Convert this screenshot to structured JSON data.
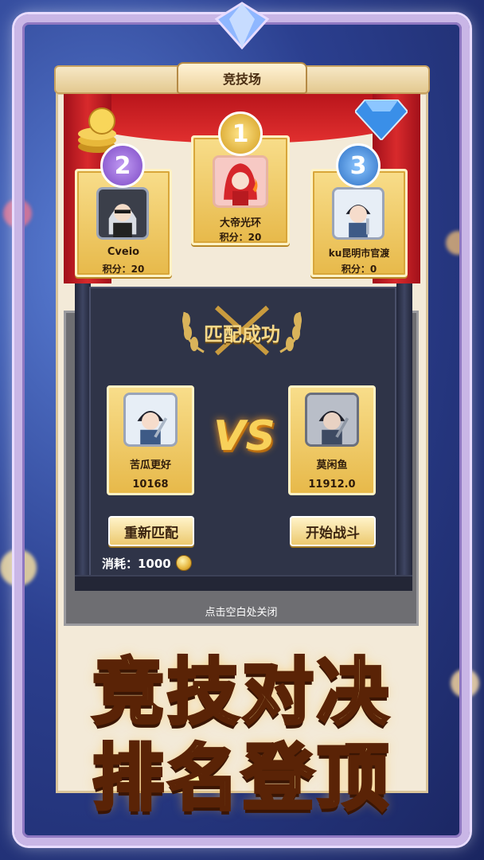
{
  "header": {
    "title": "竞技场"
  },
  "podium": [
    {
      "rank": "1",
      "name": "大帝光环",
      "score_label": "积分：20",
      "badge_color": "#e7b94a"
    },
    {
      "rank": "2",
      "name": "Cveio",
      "score_label": "积分：20",
      "badge_color": "#9a6ad6"
    },
    {
      "rank": "3",
      "name": "ku昆明市官渡",
      "score_label": "积分：0",
      "badge_color": "#3d86d8"
    }
  ],
  "match": {
    "title": "匹配成功",
    "vs": "VS",
    "player": {
      "name": "苦瓜更好",
      "score": "10168"
    },
    "opponent": {
      "name": "莫闲鱼",
      "score": "11912.0"
    },
    "rematch_label": "重新匹配",
    "start_label": "开始战斗",
    "cost_label": "消耗：1000"
  },
  "close_hint": "点击空白处关闭",
  "promo": {
    "line1": "竞技对决",
    "line2": "排名登顶"
  },
  "colors": {
    "gold": "#e7b94a",
    "dialog": "#2f3448",
    "curtain": "#d82a2c"
  }
}
